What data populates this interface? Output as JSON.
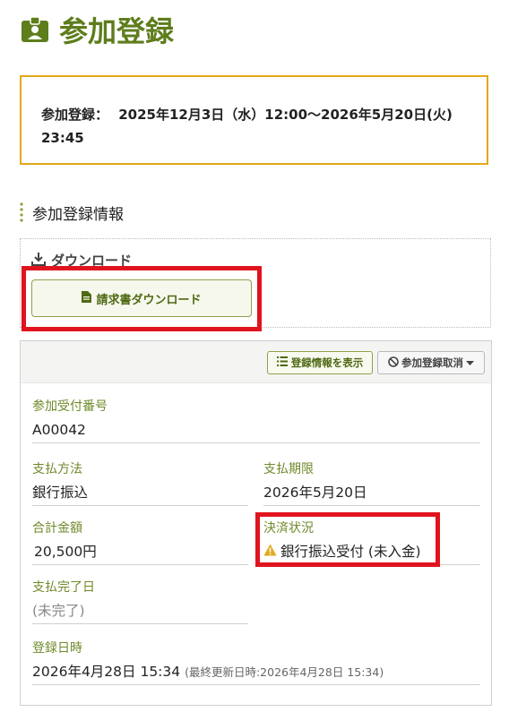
{
  "page": {
    "title": "参加登録",
    "title_icon": "badge-icon"
  },
  "period": {
    "label": "参加登録：",
    "value_line1": "2025年12月3日（水）12:00〜2026年5月20日(火)",
    "value_line2": "23:45"
  },
  "section": {
    "heading": "参加登録情報"
  },
  "download": {
    "heading": "ダウンロード",
    "heading_icon": "download-icon",
    "invoice_button": "請求書ダウンロード",
    "invoice_icon": "file-icon"
  },
  "actions": {
    "show_info": "登録情報を表示",
    "show_info_icon": "list-icon",
    "cancel": "参加登録取消",
    "cancel_icon": "ban-icon"
  },
  "fields": {
    "reception_number": {
      "label": "参加受付番号",
      "value": "A00042"
    },
    "payment_method": {
      "label": "支払方法",
      "value": "銀行振込"
    },
    "payment_deadline": {
      "label": "支払期限",
      "value": "2026年5月20日"
    },
    "total_amount": {
      "label": "合計金額",
      "value": "20,500円"
    },
    "settlement_status": {
      "label": "決済状況",
      "value": "銀行振込受付 (未入金)",
      "icon": "warning-icon"
    },
    "payment_completed_date": {
      "label": "支払完了日",
      "value": "(未完了)"
    },
    "registration_datetime": {
      "label": "登録日時",
      "value": "2026年4月28日 15:34",
      "updated": "(最終更新日時:2026年4月28日 15:34)"
    }
  },
  "colors": {
    "brand_green": "#5e7d1c",
    "label_green": "#6f8a2a",
    "warning_border": "#e2a81c",
    "highlight_red": "#e0141e",
    "warning_icon": "#e2a81c"
  }
}
